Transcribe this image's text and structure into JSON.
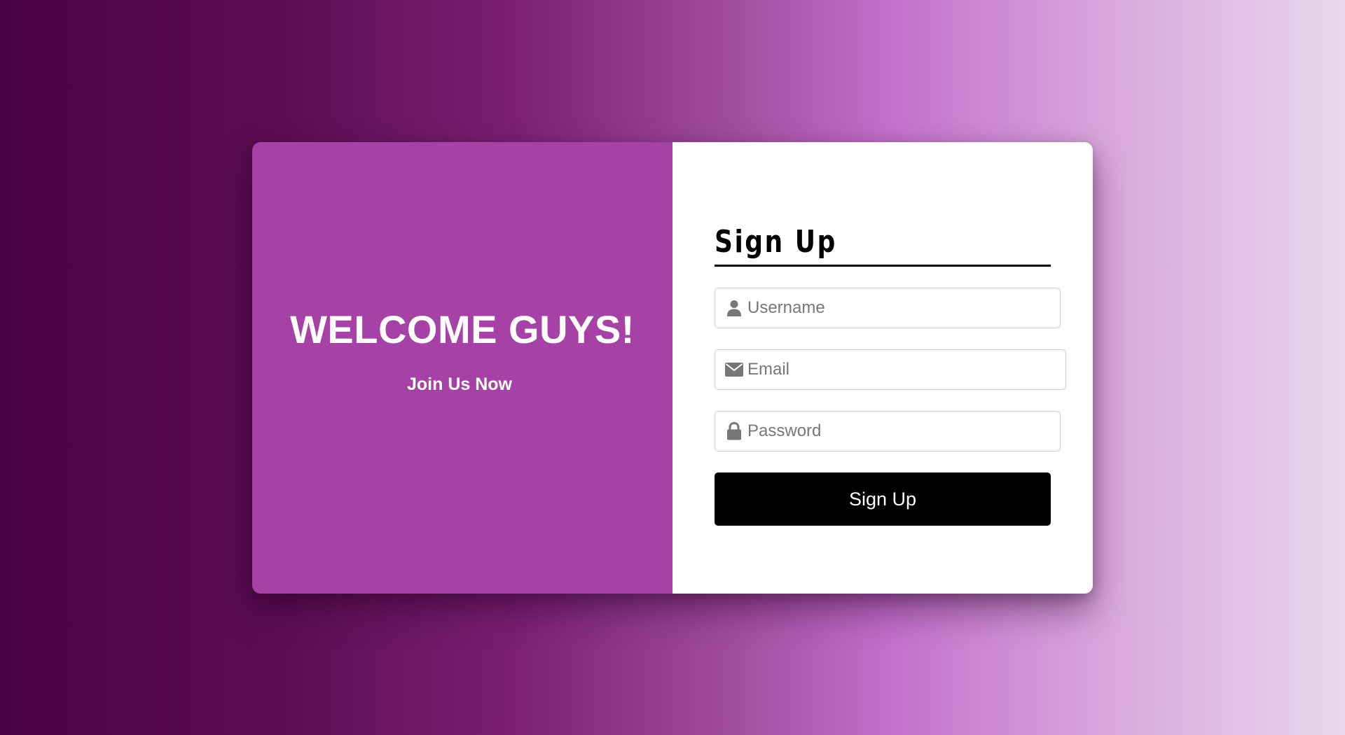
{
  "colors": {
    "background_gradient": [
      "#4a0342",
      "#7a1f72",
      "#c26fca",
      "#e8d8ec"
    ],
    "left_panel": "#a642a6",
    "right_panel": "#ffffff",
    "button": "#000000",
    "icon": "#777777"
  },
  "welcome": {
    "title": "WELCOME GUYS!",
    "subtitle": "Join Us Now"
  },
  "form": {
    "title": "Sign Up",
    "fields": {
      "username": {
        "placeholder": "Username",
        "value": "",
        "icon": "user-icon"
      },
      "email": {
        "placeholder": "Email",
        "value": "",
        "icon": "envelope-icon"
      },
      "password": {
        "placeholder": "Password",
        "value": "",
        "icon": "lock-icon"
      }
    },
    "submit_label": "Sign Up"
  }
}
